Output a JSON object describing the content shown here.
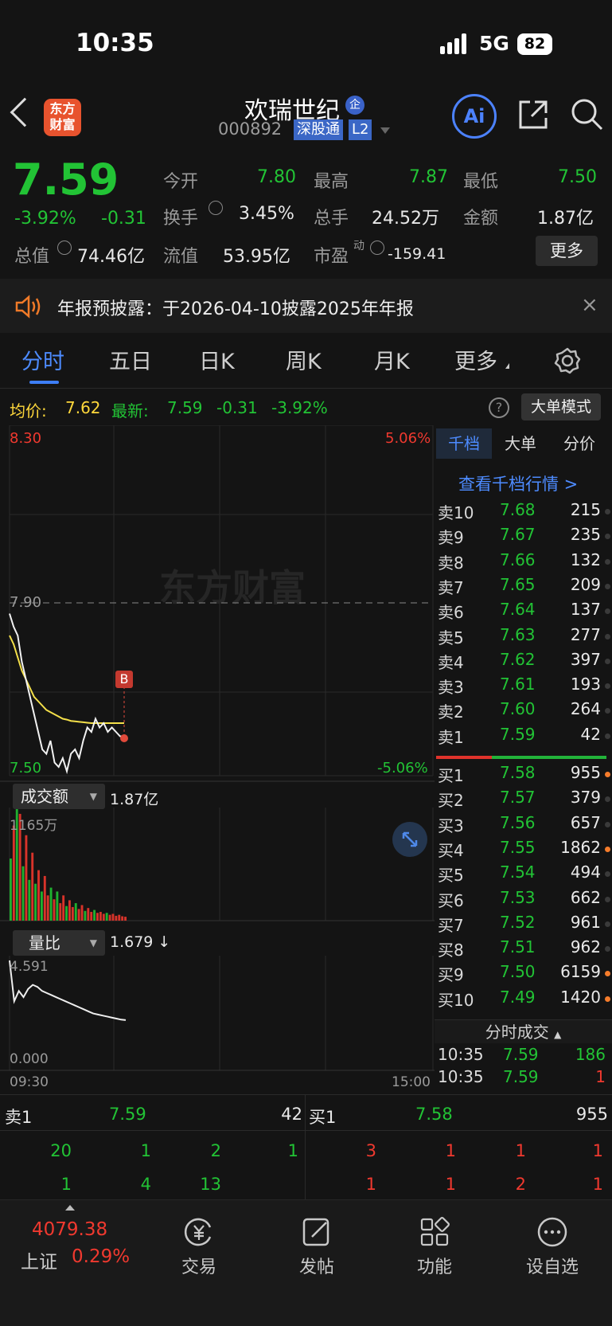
{
  "status_bar": {
    "time": "10:35",
    "network": "5G",
    "battery": "82"
  },
  "header": {
    "stock_name": "欢瑞世纪",
    "badge": "企",
    "code": "000892",
    "exchange_tag": "深股通",
    "level_tag": "L2",
    "logo_text": "东方财富",
    "ai_label": "Ai"
  },
  "quote": {
    "price": "7.59",
    "change_pct": "-3.92%",
    "change": "-0.31",
    "open_label": "今开",
    "open": "7.80",
    "high_label": "最高",
    "high": "7.87",
    "low_label": "最低",
    "low": "7.50",
    "turnover_label": "换手",
    "turnover": "3.45%",
    "volume_label": "总手",
    "volume": "24.52万",
    "amount_label": "金额",
    "amount": "1.87亿",
    "mktcap_label": "总值",
    "mktcap": "74.46亿",
    "float_label": "流值",
    "float_cap": "53.95亿",
    "pe_label": "市盈",
    "pe_sup": "动",
    "pe": "-159.41",
    "more_button": "更多"
  },
  "notice": {
    "text": "年报预披露：于2026-04-10披露2025年年报"
  },
  "tabs": [
    "分时",
    "五日",
    "日K",
    "周K",
    "月K",
    "更多"
  ],
  "infobar": {
    "avg_label": "均价:",
    "avg": "7.62",
    "latest_label": "最新:",
    "latest": "7.59",
    "chg": "-0.31",
    "chg_pct": "-3.92%",
    "mode_button": "大单模式"
  },
  "chart": {
    "top_price": "8.30",
    "top_pct": "5.06%",
    "mid_price": "7.90",
    "bottom_price": "7.50",
    "bottom_pct": "-5.06%",
    "watermark": "东方财富",
    "marker": "B",
    "volume_selector": "成交额",
    "volume_total": "1.87亿",
    "volume_max": "1165万",
    "ratio_selector": "量比",
    "ratio_value": "1.679 ↓",
    "ratio_max": "4.591",
    "ratio_min": "0.000",
    "time_start": "09:30",
    "time_end": "15:00"
  },
  "chart_data": {
    "type": "line",
    "title": "",
    "price_series": [
      7.87,
      7.84,
      7.82,
      7.76,
      7.72,
      7.68,
      7.64,
      7.6,
      7.56,
      7.55,
      7.58,
      7.53,
      7.52,
      7.54,
      7.51,
      7.55,
      7.56,
      7.54,
      7.58,
      7.61,
      7.6,
      7.63,
      7.61,
      7.62,
      7.6,
      7.61,
      7.6,
      7.59,
      7.59
    ],
    "avg_series": [
      7.82,
      7.8,
      7.77,
      7.74,
      7.72,
      7.7,
      7.68,
      7.67,
      7.66,
      7.65,
      7.645,
      7.64,
      7.635,
      7.63,
      7.628,
      7.625,
      7.624,
      7.623,
      7.622,
      7.621,
      7.62,
      7.62,
      7.62,
      7.62,
      7.62,
      7.62,
      7.62,
      7.62,
      7.62
    ],
    "ylim": [
      7.5,
      8.3
    ],
    "volume": [
      640,
      980,
      1165,
      1100,
      560,
      880,
      420,
      700,
      380,
      520,
      300,
      460,
      260,
      340,
      220,
      300,
      180,
      260,
      150,
      210,
      140,
      180,
      120,
      160,
      100,
      130,
      90,
      110,
      80,
      90,
      70,
      80,
      60,
      70,
      50,
      60,
      45,
      40
    ],
    "volume_colors": [
      "g",
      "r",
      "g",
      "r",
      "g",
      "r",
      "g",
      "r",
      "g",
      "r",
      "g",
      "r",
      "r",
      "g",
      "r",
      "g",
      "r",
      "r",
      "g",
      "r",
      "r",
      "g",
      "r",
      "r",
      "g",
      "r",
      "r",
      "g",
      "r",
      "r",
      "r",
      "g",
      "r",
      "r",
      "r",
      "r",
      "r",
      "r"
    ],
    "ratio": [
      4.591,
      2.6,
      3.1,
      2.8,
      3.2,
      3.4,
      3.3,
      3.1,
      3.0,
      2.9,
      2.8,
      2.7,
      2.6,
      2.5,
      2.4,
      2.3,
      2.2,
      2.1,
      2.0,
      1.95,
      1.9,
      1.85,
      1.8,
      1.75,
      1.7,
      1.679
    ]
  },
  "orderbook": {
    "tabs": [
      "千档",
      "大单",
      "分价"
    ],
    "link": "查看千档行情 >",
    "asks": [
      {
        "label": "卖10",
        "price": "7.68",
        "vol": "215",
        "dot": "n"
      },
      {
        "label": "卖9",
        "price": "7.67",
        "vol": "235",
        "dot": "n"
      },
      {
        "label": "卖8",
        "price": "7.66",
        "vol": "132",
        "dot": "n"
      },
      {
        "label": "卖7",
        "price": "7.65",
        "vol": "209",
        "dot": "n"
      },
      {
        "label": "卖6",
        "price": "7.64",
        "vol": "137",
        "dot": "n"
      },
      {
        "label": "卖5",
        "price": "7.63",
        "vol": "277",
        "dot": "n"
      },
      {
        "label": "卖4",
        "price": "7.62",
        "vol": "397",
        "dot": "n"
      },
      {
        "label": "卖3",
        "price": "7.61",
        "vol": "193",
        "dot": "n"
      },
      {
        "label": "卖2",
        "price": "7.60",
        "vol": "264",
        "dot": "n"
      },
      {
        "label": "卖1",
        "price": "7.59",
        "vol": "42",
        "dot": "n"
      }
    ],
    "bids": [
      {
        "label": "买1",
        "price": "7.58",
        "vol": "955",
        "dot": "o"
      },
      {
        "label": "买2",
        "price": "7.57",
        "vol": "379",
        "dot": "n"
      },
      {
        "label": "买3",
        "price": "7.56",
        "vol": "657",
        "dot": "n"
      },
      {
        "label": "买4",
        "price": "7.55",
        "vol": "1862",
        "dot": "o"
      },
      {
        "label": "买5",
        "price": "7.54",
        "vol": "494",
        "dot": "n"
      },
      {
        "label": "买6",
        "price": "7.53",
        "vol": "662",
        "dot": "n"
      },
      {
        "label": "买7",
        "price": "7.52",
        "vol": "961",
        "dot": "n"
      },
      {
        "label": "买8",
        "price": "7.51",
        "vol": "962",
        "dot": "n"
      },
      {
        "label": "买9",
        "price": "7.50",
        "vol": "6159",
        "dot": "o"
      },
      {
        "label": "买10",
        "price": "7.49",
        "vol": "1420",
        "dot": "o"
      }
    ],
    "ticks_title": "分时成交",
    "ticks": [
      {
        "time": "10:35",
        "price": "7.59",
        "vol": "186",
        "color": "g"
      },
      {
        "time": "10:35",
        "price": "7.59",
        "vol": "1",
        "color": "r"
      }
    ]
  },
  "bottom_quote": {
    "sell_label": "卖1",
    "sell_price": "7.59",
    "sell_vol": "42",
    "buy_label": "买1",
    "buy_price": "7.58",
    "buy_vol": "955",
    "sell_queue_1": [
      "20",
      "1",
      "2",
      "1"
    ],
    "sell_queue_2": [
      "1",
      "4",
      "13"
    ],
    "buy_queue_1": [
      "3",
      "1",
      "1",
      "1"
    ],
    "buy_queue_2": [
      "1",
      "1",
      "2",
      "1"
    ]
  },
  "nav": {
    "index_value": "4079.38",
    "index_name": "上证",
    "index_pct": "0.29%",
    "items": [
      "交易",
      "发帖",
      "功能",
      "设自选"
    ]
  }
}
